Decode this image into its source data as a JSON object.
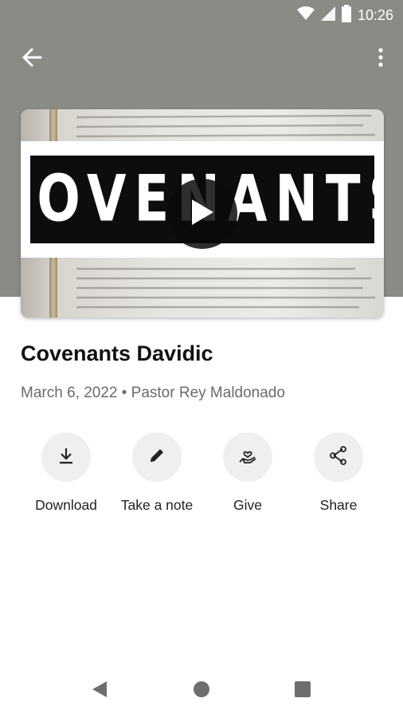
{
  "status_bar": {
    "time": "10:26",
    "icons": [
      "wifi-icon",
      "cell-signal-icon",
      "battery-icon"
    ]
  },
  "toolbar": {
    "back_icon": "arrow-left-icon",
    "menu_icon": "more-vertical-icon"
  },
  "media": {
    "title_graphic_text": "COVENANTS",
    "play_icon": "play-icon"
  },
  "sermon": {
    "title": "Covenants Davidic",
    "meta": "March 6, 2022 • Pastor Rey Maldonado"
  },
  "actions": [
    {
      "label": "Download",
      "icon": "download-icon"
    },
    {
      "label": "Take a note",
      "icon": "pencil-icon"
    },
    {
      "label": "Give",
      "icon": "give-heart-hand-icon"
    },
    {
      "label": "Share",
      "icon": "share-icon"
    }
  ],
  "nav": {
    "back": "nav-back-icon",
    "home": "nav-home-icon",
    "recents": "nav-recents-icon"
  },
  "colors": {
    "header_bg": "#8b8a85",
    "action_circle_bg": "#efefef",
    "title_text": "#111111",
    "meta_text": "#6b6b6b"
  }
}
